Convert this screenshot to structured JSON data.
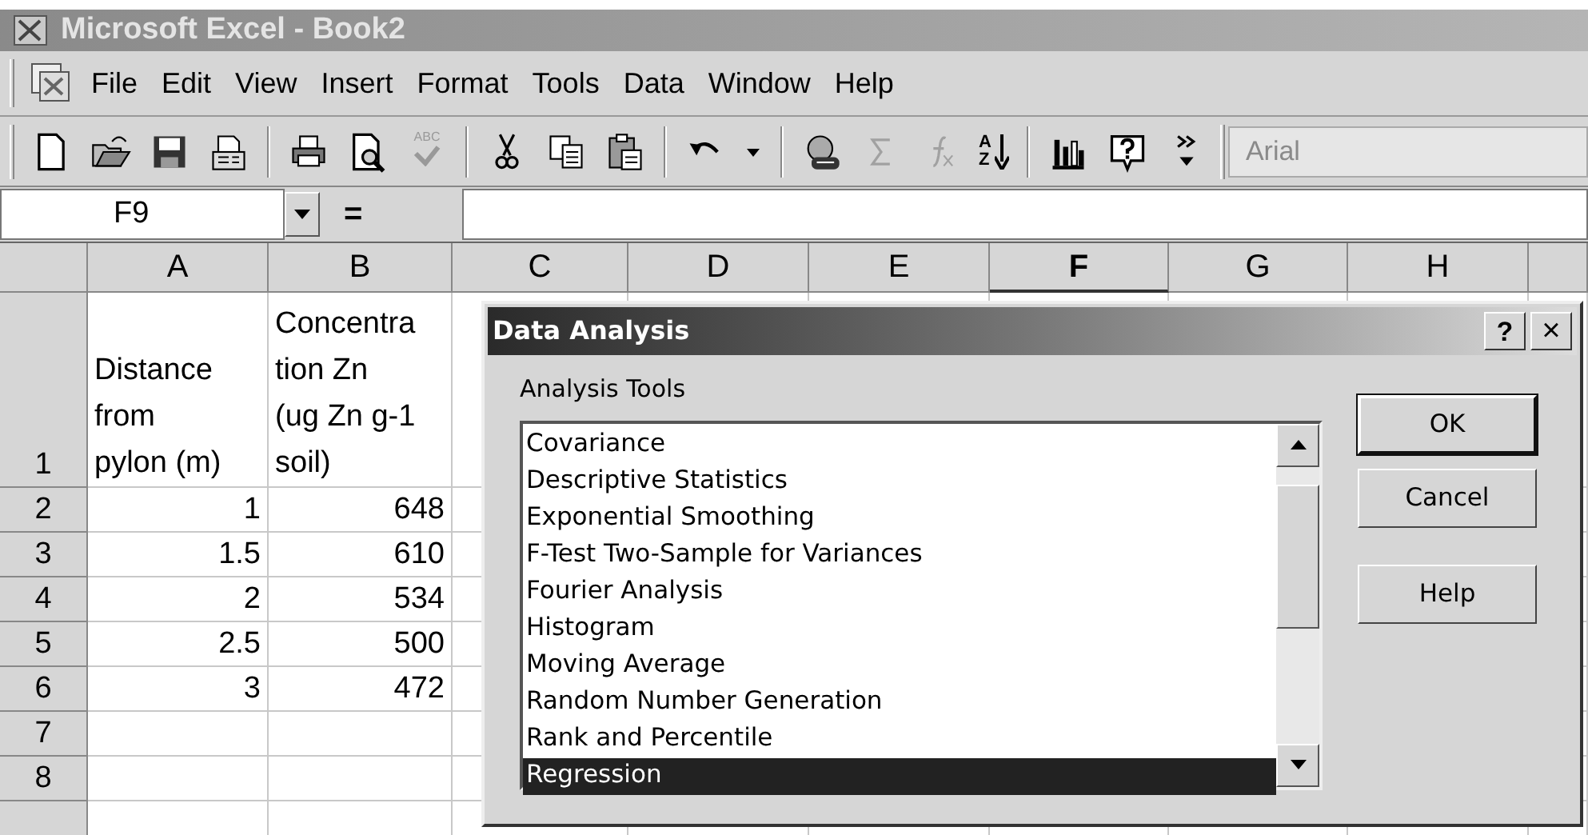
{
  "window": {
    "title": "Microsoft Excel - Book2"
  },
  "menu": [
    {
      "label": "File"
    },
    {
      "label": "Edit"
    },
    {
      "label": "View"
    },
    {
      "label": "Insert"
    },
    {
      "label": "Format"
    },
    {
      "label": "Tools"
    },
    {
      "label": "Data"
    },
    {
      "label": "Window"
    },
    {
      "label": "Help"
    }
  ],
  "toolbar": [
    {
      "kind": "new",
      "disabled": false
    },
    {
      "kind": "open",
      "disabled": false
    },
    {
      "kind": "save",
      "disabled": false
    },
    {
      "kind": "permission",
      "disabled": false
    },
    {
      "kind": "separator"
    },
    {
      "kind": "print",
      "disabled": false
    },
    {
      "kind": "preview",
      "disabled": false
    },
    {
      "kind": "spelling",
      "label": "ABC",
      "disabled": true
    },
    {
      "kind": "separator"
    },
    {
      "kind": "cut",
      "disabled": false
    },
    {
      "kind": "copy",
      "disabled": false
    },
    {
      "kind": "paste",
      "disabled": false
    },
    {
      "kind": "separator"
    },
    {
      "kind": "undo",
      "disabled": false
    },
    {
      "kind": "dropdown",
      "disabled": false
    },
    {
      "kind": "separator"
    },
    {
      "kind": "web",
      "disabled": false
    },
    {
      "kind": "sum",
      "disabled": true
    },
    {
      "kind": "function",
      "disabled": true
    },
    {
      "kind": "sort",
      "letters": [
        "A",
        "Z"
      ],
      "disabled": false
    },
    {
      "kind": "separator"
    },
    {
      "kind": "chart",
      "disabled": false
    },
    {
      "kind": "help",
      "disabled": false
    },
    {
      "kind": "overflow",
      "disabled": false
    }
  ],
  "font_box": {
    "value": "Arial"
  },
  "formula_bar": {
    "name_box": "F9",
    "equals": "="
  },
  "sheet": {
    "columns": [
      {
        "label": "A",
        "selected": false
      },
      {
        "label": "B",
        "selected": false
      },
      {
        "label": "C",
        "selected": false
      },
      {
        "label": "D",
        "selected": false
      },
      {
        "label": "E",
        "selected": false
      },
      {
        "label": "F",
        "selected": true
      },
      {
        "label": "G",
        "selected": false
      },
      {
        "label": "H",
        "selected": false
      }
    ],
    "rows": [
      {
        "header": "1",
        "kind": "heading",
        "cells": [
          "Distance\nfrom\npylon (m)",
          "Concentra\ntion Zn\n(ug Zn g-1\nsoil)"
        ]
      },
      {
        "header": "2",
        "kind": "data",
        "cells": [
          "1",
          "648"
        ]
      },
      {
        "header": "3",
        "kind": "data",
        "cells": [
          "1.5",
          "610"
        ]
      },
      {
        "header": "4",
        "kind": "data",
        "cells": [
          "2",
          "534"
        ]
      },
      {
        "header": "5",
        "kind": "data",
        "cells": [
          "2.5",
          "500"
        ]
      },
      {
        "header": "6",
        "kind": "data",
        "cells": [
          "3",
          "472"
        ]
      },
      {
        "header": "7",
        "kind": "data",
        "cells": []
      },
      {
        "header": "8",
        "kind": "data",
        "cells": []
      }
    ]
  },
  "dialog": {
    "title": "Data Analysis",
    "help_button": "?",
    "close_button": "×",
    "list_label": "Analysis Tools",
    "items": [
      {
        "label": "Covariance",
        "selected": false
      },
      {
        "label": "Descriptive Statistics",
        "selected": false
      },
      {
        "label": "Exponential Smoothing",
        "selected": false
      },
      {
        "label": "F-Test Two-Sample for Variances",
        "selected": false
      },
      {
        "label": "Fourier Analysis",
        "selected": false
      },
      {
        "label": "Histogram",
        "selected": false
      },
      {
        "label": "Moving Average",
        "selected": false
      },
      {
        "label": "Random Number Generation",
        "selected": false
      },
      {
        "label": "Rank and Percentile",
        "selected": false
      },
      {
        "label": "Regression",
        "selected": true
      }
    ],
    "buttons": [
      {
        "label": "OK",
        "default": true
      },
      {
        "label": "Cancel",
        "default": false
      },
      {
        "label": "Help",
        "default": false
      }
    ]
  }
}
